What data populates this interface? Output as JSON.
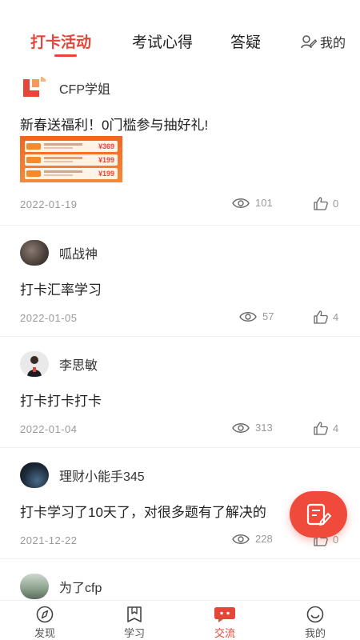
{
  "header": {
    "tabs": [
      {
        "label": "打卡活动"
      },
      {
        "label": "考试心得"
      },
      {
        "label": "答疑"
      }
    ],
    "mine_label": "我的"
  },
  "posts": [
    {
      "author": "CFP学姐",
      "text": "新春送福利！0门槛参与抽好礼!",
      "promo_prices": [
        "¥369",
        "¥199",
        "¥199"
      ],
      "date": "2022-01-19",
      "views": "101",
      "likes": "0"
    },
    {
      "author": "呱战神",
      "text": "打卡汇率学习",
      "date": "2022-01-05",
      "views": "57",
      "likes": "4"
    },
    {
      "author": "李思敏",
      "text": "打卡打卡打卡",
      "date": "2022-01-04",
      "views": "313",
      "likes": "4"
    },
    {
      "author": "理财小能手345",
      "text": "打卡学习了10天了，对很多题有了解决的",
      "date": "2021-12-22",
      "views": "228",
      "likes": "0"
    },
    {
      "author": "为了cfp"
    }
  ],
  "bottom_nav": [
    {
      "label": "发现",
      "icon": "compass-icon"
    },
    {
      "label": "学习",
      "icon": "book-icon"
    },
    {
      "label": "交流",
      "icon": "chat-icon"
    },
    {
      "label": "我的",
      "icon": "smile-icon"
    }
  ],
  "colors": {
    "accent": "#e8453a",
    "fab": "#ef4a3c",
    "meta_text": "#999999"
  }
}
